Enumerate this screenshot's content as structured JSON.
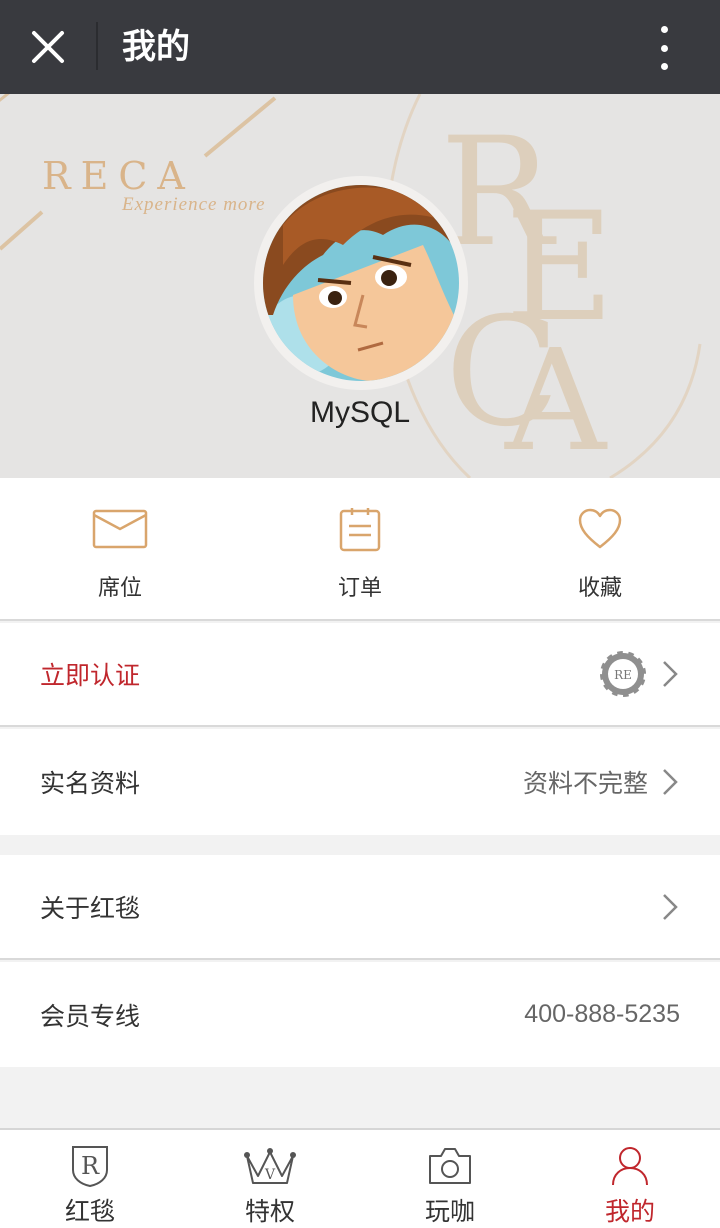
{
  "topbar": {
    "title": "我的",
    "close_icon": "close-icon",
    "more_icon": "more-vertical-icon"
  },
  "banner": {
    "brand": "RECA",
    "tagline": "Experience more",
    "username": "MySQL",
    "accent_color": "#d9b48a"
  },
  "quick_actions": [
    {
      "label": "席位",
      "icon": "envelope-icon"
    },
    {
      "label": "订单",
      "icon": "order-list-icon"
    },
    {
      "label": "收藏",
      "icon": "heart-icon"
    }
  ],
  "rows": {
    "verify": {
      "label": "立即认证",
      "badge_icon": "reca-badge-icon"
    },
    "realname": {
      "label": "实名资料",
      "value": "资料不完整"
    },
    "about": {
      "label": "关于红毯"
    },
    "hotline": {
      "label": "会员专线",
      "value": "400-888-5235"
    }
  },
  "tabs": [
    {
      "label": "红毯",
      "icon": "reca-shield-icon",
      "active": false
    },
    {
      "label": "特权",
      "icon": "crown-icon",
      "active": false
    },
    {
      "label": "玩咖",
      "icon": "camera-icon",
      "active": false
    },
    {
      "label": "我的",
      "icon": "user-icon",
      "active": true
    }
  ],
  "colors": {
    "topbar": "#393a3f",
    "accent_red": "#c0272d",
    "gold": "#d9b48a"
  }
}
